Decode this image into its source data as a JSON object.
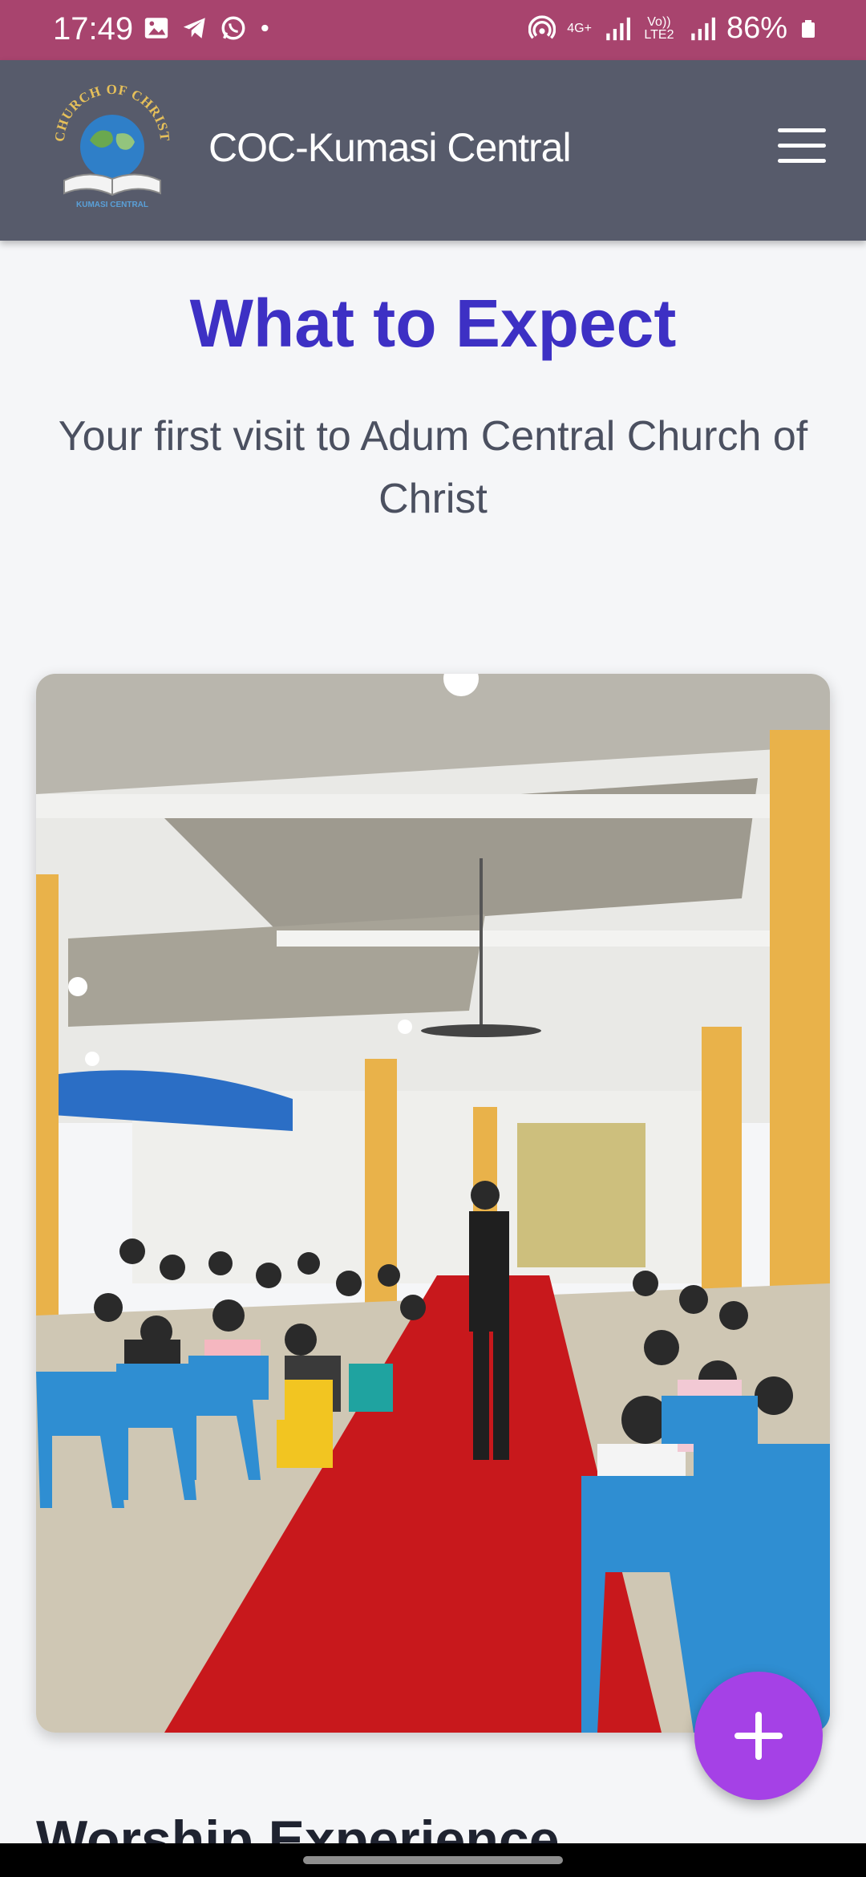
{
  "status_bar": {
    "time": "17:49",
    "network_4g": "4G+",
    "volte_label": "Vo)) LTE2",
    "battery": "86%",
    "icons": [
      "gallery-icon",
      "telegram-icon",
      "whatsapp-icon",
      "dot-icon",
      "hotspot-icon",
      "signal-icon",
      "signal-icon",
      "battery-icon"
    ]
  },
  "header": {
    "logo_text_top": "CHURCH OF CHRIST",
    "logo_text_bottom": "KUMASI CENTRAL",
    "title": "COC-Kumasi Central",
    "menu_icon": "hamburger-menu-icon"
  },
  "hero": {
    "title": "What to Expect",
    "subtitle": "Your first visit to Adum Central Church of Christ"
  },
  "section": {
    "heading": "Worship Experience"
  },
  "fab": {
    "icon": "plus-icon"
  },
  "colors": {
    "status_bar": "#a8446e",
    "header": "#575b6b",
    "title_accent": "#3d30c4",
    "fab": "#a541e6",
    "carpet": "#c8181c",
    "pillar": "#e9b24a",
    "chair": "#2f8ed2"
  }
}
